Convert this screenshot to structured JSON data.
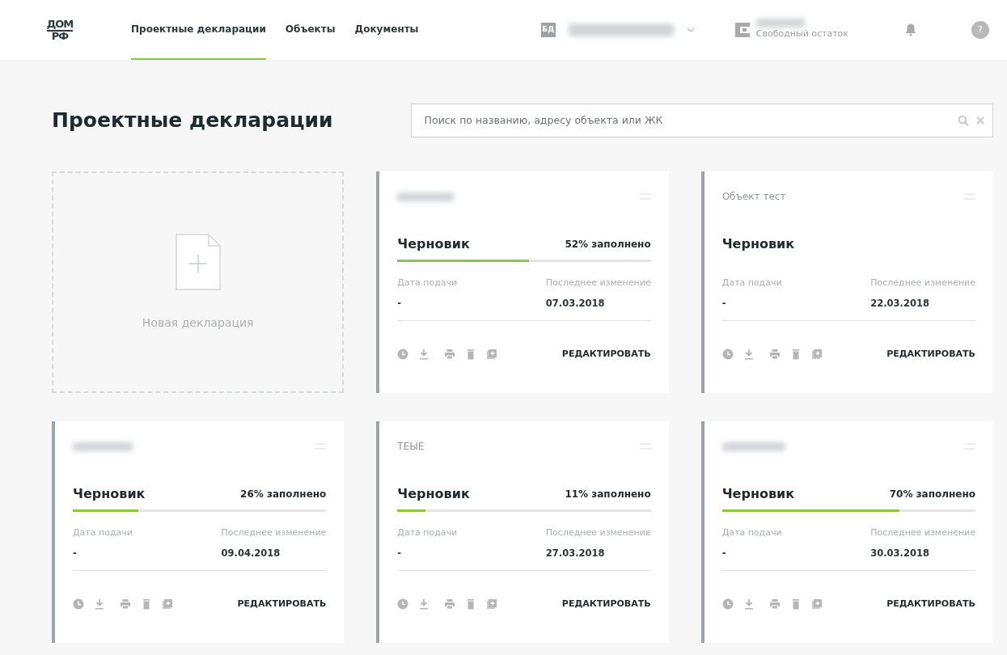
{
  "logo": {
    "top": "ДОМ",
    "bottom": "РФ"
  },
  "nav": [
    {
      "label": "Проектные декларации",
      "selected": true
    },
    {
      "label": "Объекты",
      "selected": false
    },
    {
      "label": "Документы",
      "selected": false
    }
  ],
  "company": {
    "badge": "БД"
  },
  "balance": {
    "caption": "Свободный остаток"
  },
  "help": "?",
  "page_title": "Проектные декларации",
  "search": {
    "placeholder": "Поиск по названию, адресу объекта или ЖК",
    "clear": "×"
  },
  "new_card": {
    "label": "Новая декларация"
  },
  "cards": [
    {
      "status": "Черновик",
      "progress": "52% заполнено",
      "level": 0.52,
      "submitted_label": "Дата подачи",
      "submitted": "-",
      "changed_label": "Последнее изменение",
      "changed": "07.03.2018",
      "action": "РЕДАКТИРОВАТЬ"
    },
    {
      "title": "Объект тест",
      "status": "Черновик",
      "submitted_label": "Дата подачи",
      "submitted": "-",
      "changed_label": "Последнее изменение",
      "changed": "22.03.2018",
      "action": "РЕДАКТИРОВАТЬ"
    },
    {
      "status": "Черновик",
      "progress": "26% заполнено",
      "level": 0.26,
      "submitted_label": "Дата подачи",
      "submitted": "-",
      "changed_label": "Последнее изменение",
      "changed": "09.04.2018",
      "action": "РЕДАКТИРОВАТЬ"
    },
    {
      "title": "ТЕЫЕ",
      "status": "Черновик",
      "progress": "11% заполнено",
      "level": 0.11,
      "submitted_label": "Дата подачи",
      "submitted": "-",
      "changed_label": "Последнее изменение",
      "changed": "27.03.2018",
      "action": "РЕДАКТИРОВАТЬ"
    },
    {
      "status": "Черновик",
      "progress": "70% заполнено",
      "level": 0.7,
      "submitted_label": "Дата подачи",
      "submitted": "-",
      "changed_label": "Последнее изменение",
      "changed": "30.03.2018",
      "action": "РЕДАКТИРОВАТЬ"
    }
  ]
}
